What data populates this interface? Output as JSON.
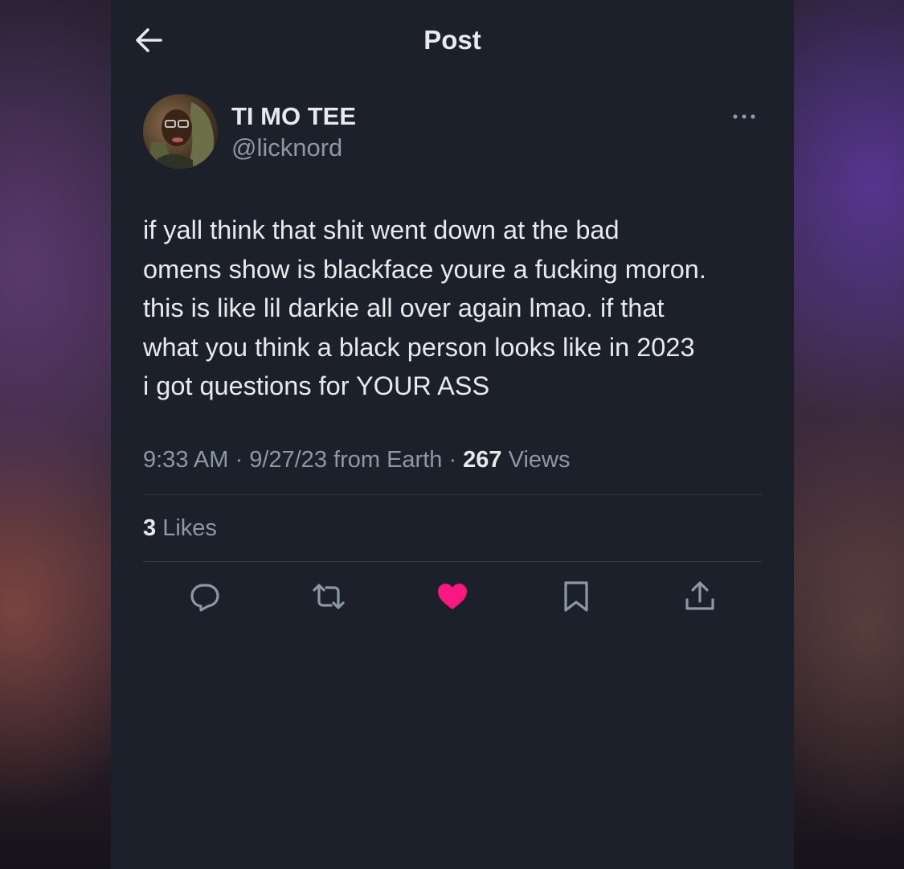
{
  "header": {
    "title": "Post",
    "back_icon": "arrow-left-icon"
  },
  "author": {
    "display_name": "TI MO TEE",
    "handle": "@licknord",
    "more_icon": "more-horizontal-icon"
  },
  "tweet": {
    "lines": [
      "if yall think that shit went down at the bad",
      "omens show is blackface youre a fucking moron.",
      "this is like lil darkie all over again lmao. if that",
      "what you think a black person looks like in 2023",
      "i got questions for YOUR ASS"
    ]
  },
  "meta": {
    "time": "9:33 AM",
    "separator": " · ",
    "date": "9/27/23",
    "source": " from Earth",
    "views_count": "267",
    "views_label": " Views"
  },
  "engagement": {
    "likes_count": "3",
    "likes_label": " Likes"
  },
  "actions": [
    {
      "icon": "reply-icon"
    },
    {
      "icon": "retweet-icon"
    },
    {
      "icon": "like-icon-filled",
      "active": true
    },
    {
      "icon": "bookmark-icon"
    },
    {
      "icon": "share-icon"
    }
  ],
  "colors": {
    "background": "#1b202a",
    "text_primary": "#e7e9ea",
    "text_secondary": "#8b98a5",
    "divider": "#313842",
    "like_active": "#f91880"
  }
}
